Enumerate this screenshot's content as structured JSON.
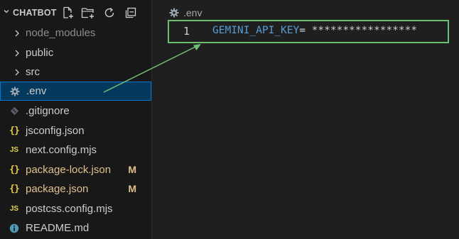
{
  "explorer": {
    "title": "CHATBOT",
    "actions": [
      "new-file-icon",
      "new-folder-icon",
      "refresh-icon",
      "collapse-all-icon"
    ],
    "items": [
      {
        "label": "node_modules",
        "kind": "folder",
        "icon": "chevron-right-icon",
        "muted": true
      },
      {
        "label": "public",
        "kind": "folder",
        "icon": "chevron-right-icon"
      },
      {
        "label": "src",
        "kind": "folder",
        "icon": "chevron-right-icon"
      },
      {
        "label": ".env",
        "kind": "file",
        "icon": "gear-icon",
        "selected": true
      },
      {
        "label": ".gitignore",
        "kind": "file",
        "icon": "git-icon"
      },
      {
        "label": "jsconfig.json",
        "kind": "file",
        "icon": "json-braces-icon"
      },
      {
        "label": "next.config.mjs",
        "kind": "file",
        "icon": "js-icon",
        "icon_text": "JS"
      },
      {
        "label": "package-lock.json",
        "kind": "file",
        "icon": "json-braces-icon",
        "badge": "M"
      },
      {
        "label": "package.json",
        "kind": "file",
        "icon": "json-braces-icon",
        "badge": "M"
      },
      {
        "label": "postcss.config.mjs",
        "kind": "file",
        "icon": "js-icon",
        "icon_text": "JS"
      },
      {
        "label": "README.md",
        "kind": "file",
        "icon": "info-icon"
      }
    ],
    "braces_glyph": "{}",
    "colors": {
      "selected_bg": "#04395e",
      "selected_border": "#0078d4",
      "modified": "#e2c08d",
      "json_icon": "#e6c84a",
      "js_icon": "#e8d44d"
    }
  },
  "editor": {
    "breadcrumb": ".env",
    "breadcrumb_icon": "gear-icon",
    "lines": [
      {
        "number": "1",
        "key": "GEMINI_API_KEY",
        "operator": "=",
        "value": " *****************"
      }
    ],
    "colors": {
      "key": "#569cd6",
      "highlight_box": "#6fbf73",
      "arrow": "#6fbf73"
    }
  }
}
